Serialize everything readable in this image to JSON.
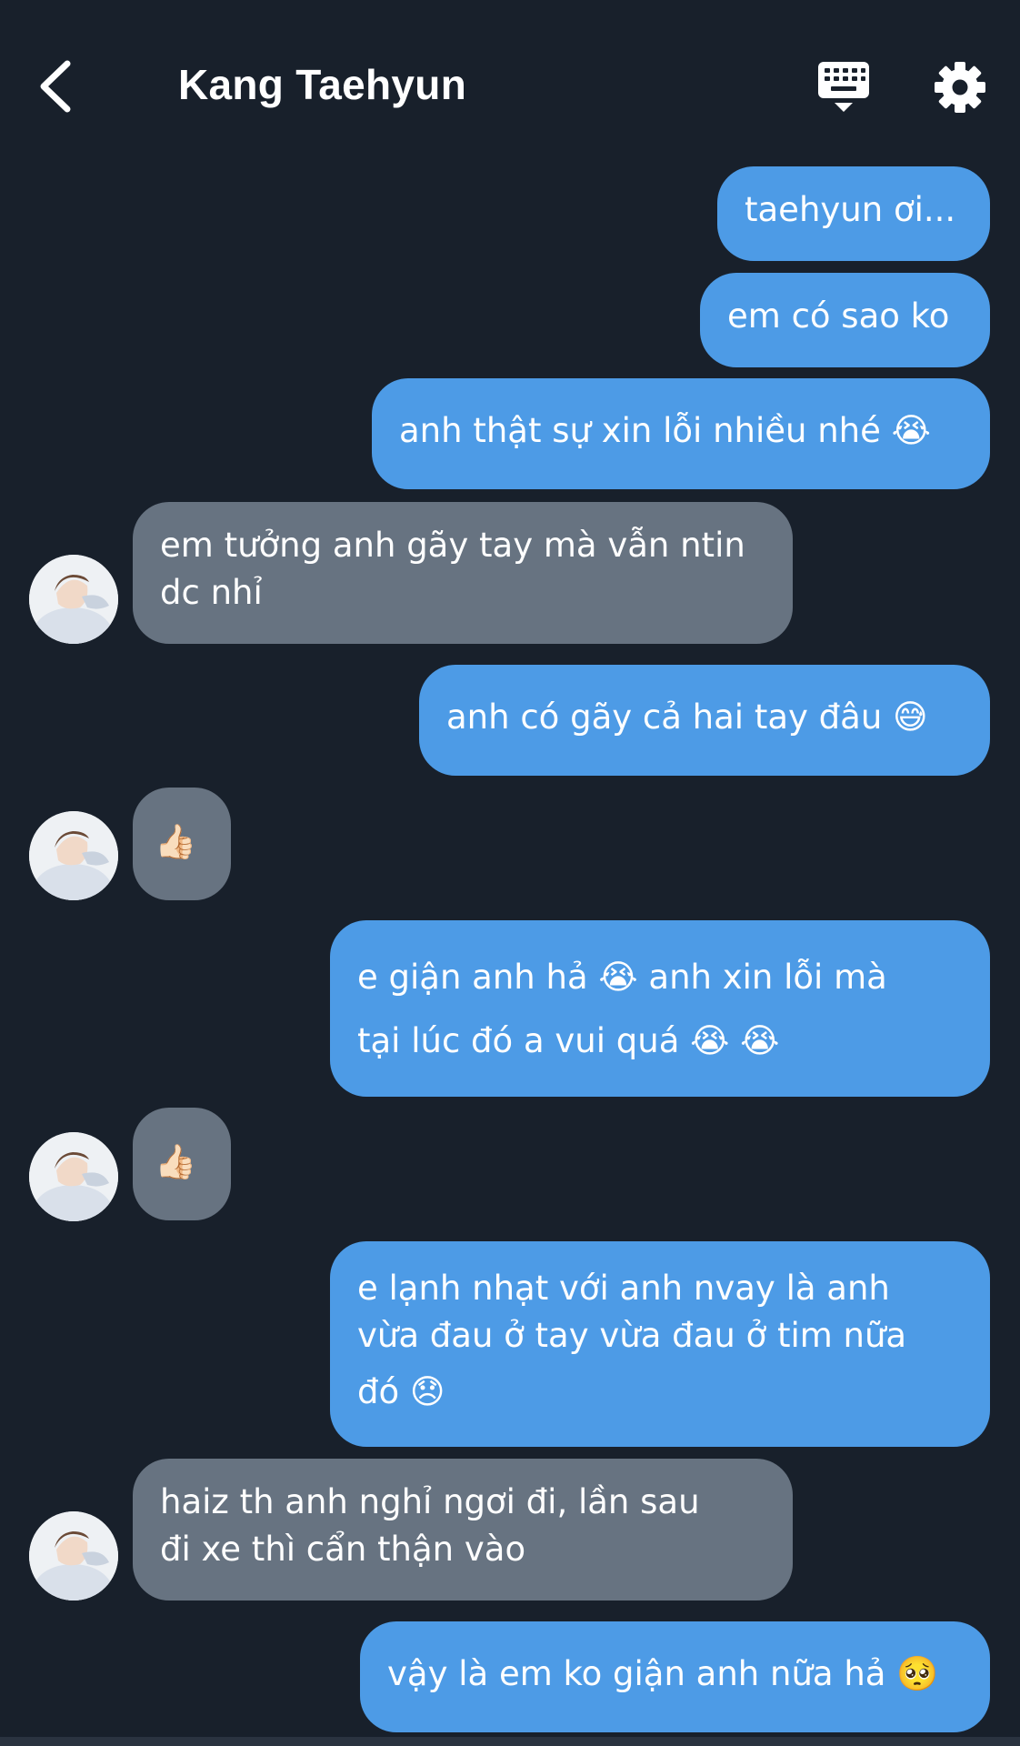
{
  "header": {
    "title": "Kang Taehyun",
    "back_icon": "chevron-left-icon",
    "keyboard_icon": "keyboard-icon",
    "settings_icon": "gear-icon"
  },
  "colors": {
    "background": "#18202b",
    "outgoing_bubble": "#4d9be6",
    "incoming_bubble": "#677381",
    "text": "#ffffff"
  },
  "messages": [
    {
      "dir": "out",
      "lines": [
        "taehyun ơi..."
      ]
    },
    {
      "dir": "out",
      "lines": [
        "em có sao ko"
      ]
    },
    {
      "dir": "out",
      "lines": [
        "anh thật sự xin lỗi nhiều nhé 😭"
      ]
    },
    {
      "dir": "in",
      "lines": [
        "em tưởng anh gãy tay mà vẫn ntin",
        "dc nhỉ"
      ]
    },
    {
      "dir": "out",
      "lines": [
        "anh có gãy cả hai tay đâu 😅"
      ]
    },
    {
      "dir": "in",
      "lines": [
        "👍🏻"
      ]
    },
    {
      "dir": "out",
      "lines": [
        "e giận anh hả 😭  anh xin lỗi mà",
        "tại lúc đó a vui quá 😭 😭"
      ]
    },
    {
      "dir": "in",
      "lines": [
        "👍🏻"
      ]
    },
    {
      "dir": "out",
      "lines": [
        "e lạnh nhạt với anh nvay là anh",
        "vừa đau ở tay vừa đau ở tim nữa",
        "đó 😞"
      ]
    },
    {
      "dir": "in",
      "lines": [
        "haiz th anh nghỉ ngơi đi, lần sau",
        "đi xe thì cẩn thận vào"
      ]
    },
    {
      "dir": "out",
      "lines": [
        "vậy là em ko giận anh nữa hả 🥺"
      ]
    }
  ]
}
